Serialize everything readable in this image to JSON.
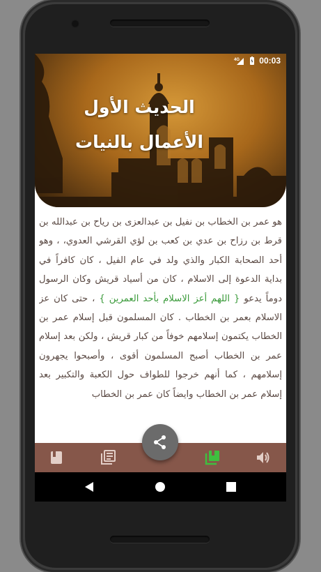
{
  "status_bar": {
    "network": "4G",
    "time": "00:03",
    "icons": [
      "signal-icon",
      "battery-icon"
    ]
  },
  "header": {
    "title_line1": "الحديث الأول",
    "title_line2": "الأعمال بالنيات"
  },
  "article": {
    "part1": "هو عمر بن الخطاب بن نفيل بن عبدالعزى بن رياح بن عبدالله بن قرط بن رزاح بن عدي بن كعب بن لؤي القرشي العدوي، ، وهو أحد الصحابة الكبار والذي ولد في عام الفيل ، كان كافراً في بداية الدعوة إلى الاسلام ، كان من أسياد قريش وكان الرسول دوماً يدعو ",
    "highlight": "{ اللهم أعز الاسلام بأحد العمرين }",
    "part2": " ، حتى كان عز الاسلام بعمر بن الخطاب . كان المسلمون قبل إسلام عمر بن الخطاب يكتمون إسلامهم خوفاً من كبار قريش ، ولكن بعد إسلام عمر بن الخطاب أصبح المسلمون أقوى ، وأصبحوا يجهرون إسلامهم ، كما أنهم خرجوا للطواف حول الكعبة والتكبير بعد إسلام عمر بن الخطاب وايضاً كان عمر بن الخطاب"
  },
  "bottom_nav": {
    "items": [
      "book-icon",
      "library-icon",
      "collections-icon",
      "volume-icon"
    ],
    "active": "collections-icon",
    "colors": {
      "background": "#86574a",
      "icon": "#e3cfc8",
      "active": "#3fbf3f"
    }
  },
  "fab": {
    "icon": "share-icon",
    "color": "#6b6b6b"
  },
  "system_nav": {
    "items": [
      "back-icon",
      "home-icon",
      "recents-icon"
    ]
  }
}
